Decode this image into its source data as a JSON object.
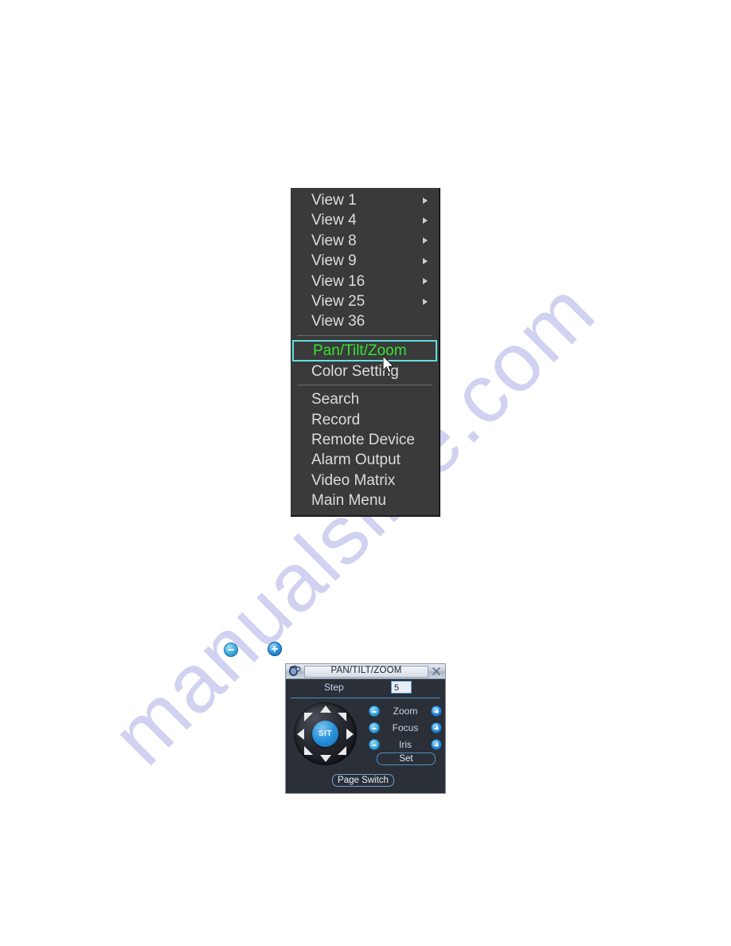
{
  "page": {
    "background_color": "#ffffff",
    "watermark_text": "manualslive.com",
    "watermark_color": "#c9c9ef"
  },
  "context_menu": {
    "background_color": "#3a3a3a",
    "text_color": "#dcdcdc",
    "selected_text_color": "#36e236",
    "selected_border_color": "#63e0e0",
    "items": [
      {
        "label": "View 1",
        "has_submenu": true,
        "selected": false
      },
      {
        "label": "View 4",
        "has_submenu": true,
        "selected": false
      },
      {
        "label": "View 8",
        "has_submenu": true,
        "selected": false
      },
      {
        "label": "View 9",
        "has_submenu": true,
        "selected": false
      },
      {
        "label": "View 16",
        "has_submenu": true,
        "selected": false
      },
      {
        "label": "View 25",
        "has_submenu": true,
        "selected": false
      },
      {
        "label": "View 36",
        "has_submenu": false,
        "selected": false
      },
      {
        "label": "Pan/Tilt/Zoom",
        "has_submenu": false,
        "selected": true
      },
      {
        "label": "Color Setting",
        "has_submenu": false,
        "selected": false
      },
      {
        "label": "Search",
        "has_submenu": false,
        "selected": false
      },
      {
        "label": "Record",
        "has_submenu": false,
        "selected": false
      },
      {
        "label": "Remote Device",
        "has_submenu": false,
        "selected": false
      },
      {
        "label": "Alarm Output",
        "has_submenu": false,
        "selected": false
      },
      {
        "label": "Video Matrix",
        "has_submenu": false,
        "selected": false
      },
      {
        "label": "Main Menu",
        "has_submenu": false,
        "selected": false
      }
    ]
  },
  "floating_icons": [
    {
      "name": "minus-icon",
      "glyph": "minus"
    },
    {
      "name": "plus-icon",
      "glyph": "plus"
    }
  ],
  "ptz_panel": {
    "title": "PAN/TILT/ZOOM",
    "close_label": "×",
    "app_icon": "ptz-camera-icon",
    "step": {
      "label": "Step",
      "value": "5"
    },
    "dpad": {
      "center_label": "SIT",
      "directions": [
        "up",
        "up-left",
        "up-right",
        "left",
        "right",
        "down",
        "down-left",
        "down-right"
      ]
    },
    "lens_controls": [
      {
        "label": "Zoom",
        "minus": "-",
        "plus": "+"
      },
      {
        "label": "Focus",
        "minus": "-",
        "plus": "+"
      },
      {
        "label": "Iris",
        "minus": "-",
        "plus": "+"
      }
    ],
    "set_button": "Set",
    "page_switch_button": "Page Switch",
    "accent_color": "#4f90c4",
    "background_color": "#2a2f38"
  }
}
